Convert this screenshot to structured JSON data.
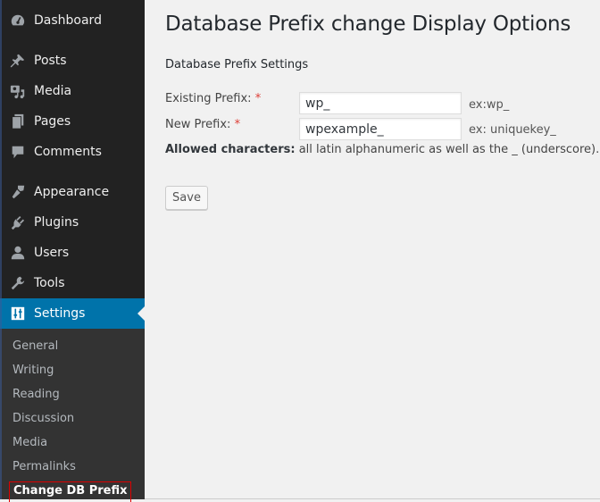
{
  "sidebar": {
    "items": [
      {
        "label": "Dashboard",
        "icon": "dashboard-icon"
      },
      {
        "label": "Posts",
        "icon": "pin-icon"
      },
      {
        "label": "Media",
        "icon": "media-icon"
      },
      {
        "label": "Pages",
        "icon": "pages-icon"
      },
      {
        "label": "Comments",
        "icon": "comment-icon"
      },
      {
        "label": "Appearance",
        "icon": "paintbrush-icon"
      },
      {
        "label": "Plugins",
        "icon": "plug-icon"
      },
      {
        "label": "Users",
        "icon": "user-icon"
      },
      {
        "label": "Tools",
        "icon": "wrench-icon"
      },
      {
        "label": "Settings",
        "icon": "settings-sliders-icon",
        "active": true
      }
    ],
    "submenu": [
      {
        "label": "General"
      },
      {
        "label": "Writing"
      },
      {
        "label": "Reading"
      },
      {
        "label": "Discussion"
      },
      {
        "label": "Media"
      },
      {
        "label": "Permalinks"
      },
      {
        "label": "Change DB Prefix",
        "current": true
      }
    ]
  },
  "main": {
    "title": "Database Prefix change Display Options",
    "section_title": "Database Prefix Settings",
    "fields": [
      {
        "label": "Existing Prefix:",
        "required_mark": "*",
        "value": "wp_",
        "hint": "ex:wp_"
      },
      {
        "label": "New Prefix:",
        "required_mark": "*",
        "value": "wpexample_",
        "hint": "ex: uniquekey_"
      }
    ],
    "allowed_label": "Allowed characters:",
    "allowed_text": " all latin alphanumeric as well as the _ (underscore).",
    "save_label": "Save"
  },
  "colors": {
    "sidebar_bg": "#222222",
    "submenu_bg": "#333333",
    "active_bg": "#0073aa",
    "required": "#dd3d36",
    "highlight_border": "#dd0000"
  }
}
